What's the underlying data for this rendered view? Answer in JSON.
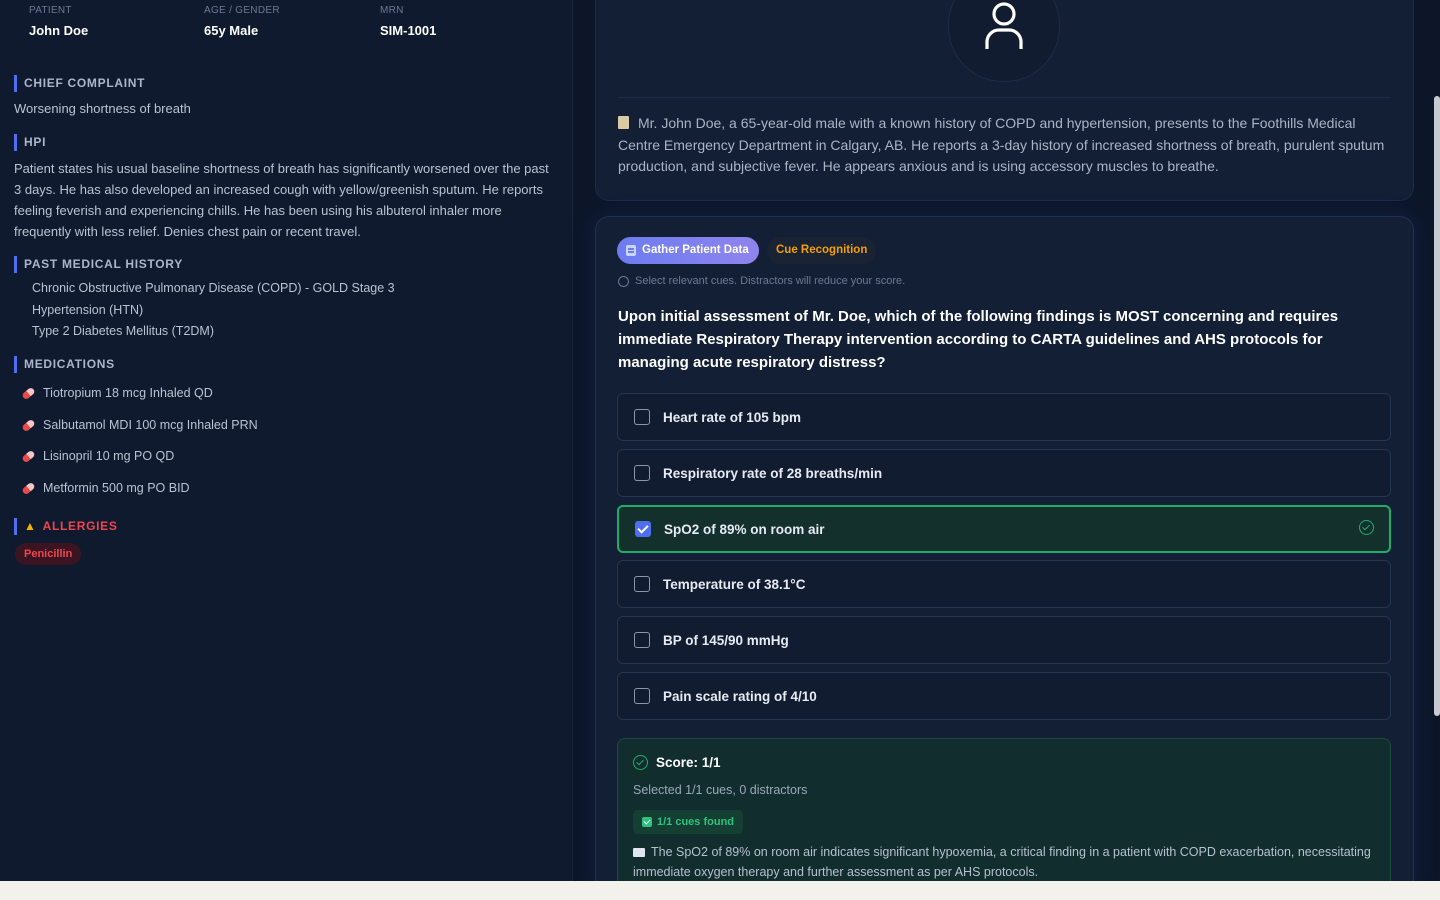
{
  "patient_header": {
    "patient_label": "PATIENT",
    "patient_value": "John Doe",
    "age_label": "AGE / GENDER",
    "age_value": "65y Male",
    "mrn_label": "MRN",
    "mrn_value": "SIM-1001"
  },
  "sections": {
    "chief_complaint_title": "CHIEF COMPLAINT",
    "chief_complaint": "Worsening shortness of breath",
    "hpi_title": "HPI",
    "hpi": "Patient states his usual baseline shortness of breath has significantly worsened over the past 3 days. He has also developed an increased cough with yellow/greenish sputum. He reports feeling feverish and experiencing chills. He has been using his albuterol inhaler more frequently with less relief. Denies chest pain or recent travel.",
    "pmh_title": "PAST MEDICAL HISTORY",
    "pmh": [
      "Chronic Obstructive Pulmonary Disease (COPD) - GOLD Stage 3",
      "Hypertension (HTN)",
      "Type 2 Diabetes Mellitus (T2DM)"
    ],
    "medications_title": "MEDICATIONS",
    "medications": [
      "Tiotropium 18 mcg Inhaled QD",
      "Salbutamol MDI 100 mcg Inhaled PRN",
      "Lisinopril 10 mg PO QD",
      "Metformin 500 mg PO BID"
    ],
    "allergies_title": "ALLERGIES",
    "allergies": [
      "Penicillin"
    ]
  },
  "intro": {
    "text": "Mr. John Doe, a 65-year-old male with a known history of COPD and hypertension, presents to the Foothills Medical Centre Emergency Department in Calgary, AB. He reports a 3-day history of increased shortness of breath, purulent sputum production, and subjective fever. He appears anxious and is using accessory muscles to breathe."
  },
  "question": {
    "tab_active": "Gather Patient Data",
    "tab_inactive": "Cue Recognition",
    "hint": "Select relevant cues. Distractors will reduce your score.",
    "text": "Upon initial assessment of Mr. Doe, which of the following findings is MOST concerning and requires immediate Respiratory Therapy intervention according to CARTA guidelines and AHS protocols for managing acute respiratory distress?",
    "options": [
      {
        "label": "Heart rate of 105 bpm",
        "selected": false
      },
      {
        "label": "Respiratory rate of 28 breaths/min",
        "selected": false
      },
      {
        "label": "SpO2 of 89% on room air",
        "selected": true
      },
      {
        "label": "Temperature of 38.1°C",
        "selected": false
      },
      {
        "label": "BP of 145/90 mmHg",
        "selected": false
      },
      {
        "label": "Pain scale rating of 4/10",
        "selected": false
      }
    ]
  },
  "score": {
    "title": "Score: 1/1",
    "detail": "Selected 1/1 cues, 0 distractors",
    "badge": "1/1 cues found",
    "explanation": "The SpO2 of 89% on room air indicates significant hypoxemia, a critical finding in a patient with COPD exacerbation, necessitating immediate oxygen therapy and further assessment as per AHS protocols."
  }
}
